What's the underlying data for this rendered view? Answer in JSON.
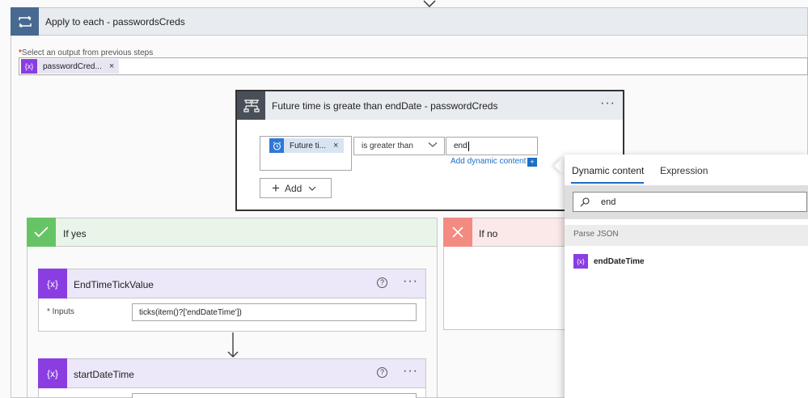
{
  "apply_each": {
    "title": "Apply to each - passwordsCreds",
    "select_required_mark": "*",
    "select_label": "Select an output from previous steps",
    "token_icon": "{x}",
    "token_label": "passwordCred...",
    "token_remove": "×"
  },
  "condition": {
    "title": "Future time is greate than endDate - passwordCreds",
    "more": "···",
    "token_label": "Future ti...",
    "token_remove": "×",
    "token_icon": "alarm-clock-icon",
    "operator": "is greater than",
    "value": "end",
    "add_dynamic": "Add dynamic content",
    "add_dynamic_plus": "+",
    "add_button": "Add"
  },
  "if_yes": {
    "title": "If yes"
  },
  "if_no": {
    "title": "If no"
  },
  "actions": [
    {
      "title": "EndTimeTickValue",
      "icon": "{x}",
      "help": "?",
      "more": "···",
      "input_label": "Inputs",
      "input_value": "ticks(item()?['endDateTime'])"
    },
    {
      "title": "startDateTime",
      "icon": "{x}",
      "help": "?",
      "more": "···"
    }
  ],
  "dynamic_panel": {
    "tab_dynamic": "Dynamic content",
    "tab_expression": "Expression",
    "search_value": "end",
    "section": "Parse JSON",
    "item_icon": "{x}",
    "item_label": "endDateTime"
  },
  "colors": {
    "apply_header_icon": "#486991",
    "condition_icon": "#484f58",
    "yes_green": "#67c466",
    "no_red": "#f28b82",
    "variable_purple": "#8a3ee2",
    "link_blue": "#1e6ec4"
  }
}
